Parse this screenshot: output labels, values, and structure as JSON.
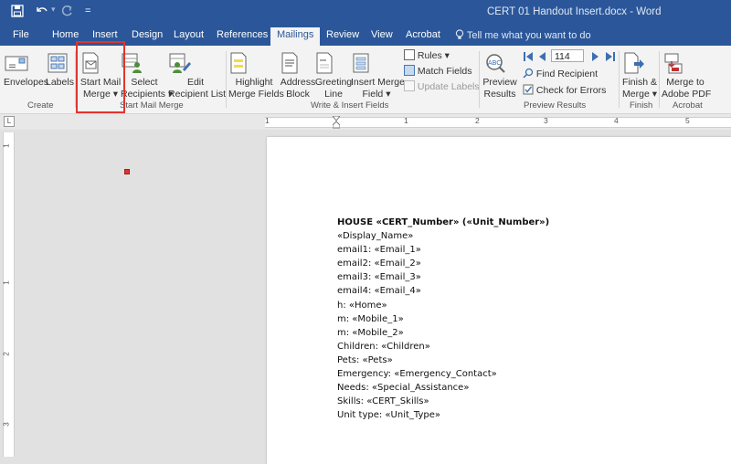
{
  "window": {
    "title": "CERT 01 Handout Insert.docx  -  Word"
  },
  "quick_access": {
    "save_icon": "save-icon",
    "undo_icon": "undo-icon",
    "redo_icon": "redo-icon",
    "customize_label": "="
  },
  "tabs": [
    {
      "label": "File"
    },
    {
      "label": "Home"
    },
    {
      "label": "Insert"
    },
    {
      "label": "Design"
    },
    {
      "label": "Layout"
    },
    {
      "label": "References"
    },
    {
      "label": "Mailings",
      "active": true
    },
    {
      "label": "Review"
    },
    {
      "label": "View"
    },
    {
      "label": "Acrobat"
    }
  ],
  "tell_me": "Tell me what you want to do",
  "ribbon": {
    "envelopes": "Envelopes",
    "labels": "Labels",
    "start_mail_1": "Start Mail",
    "start_mail_2": "Merge ▾",
    "select_1": "Select",
    "select_2": "Recipients ▾",
    "edit_1": "Edit",
    "edit_2": "Recipient List",
    "highlight_1": "Highlight",
    "highlight_2": "Merge Fields",
    "address_1": "Address",
    "address_2": "Block",
    "greeting_1": "Greeting",
    "greeting_2": "Line",
    "insert_1": "Insert Merge",
    "insert_2": "Field ▾",
    "rules": "Rules ▾",
    "match_fields": "Match Fields",
    "update_labels": "Update Labels",
    "preview_1": "Preview",
    "preview_2": "Results",
    "record_value": "114",
    "find_recipient": "Find Recipient",
    "check_errors": "Check for Errors",
    "finish_1": "Finish &",
    "finish_2": "Merge ▾",
    "adobe_1": "Merge to",
    "adobe_2": "Adobe PDF",
    "groups": {
      "create": "Create",
      "start": "Start Mail Merge",
      "write": "Write & Insert Fields",
      "preview": "Preview Results",
      "finish": "Finish",
      "acrobat": "Acrobat"
    }
  },
  "ruler": {
    "corner": "L",
    "numbers": [
      "1",
      "1",
      "2",
      "3",
      "4",
      "5"
    ],
    "vertical_numbers": [
      "1",
      "1",
      "2",
      "3"
    ]
  },
  "document": {
    "lines": [
      "HOUSE «CERT_Number» («Unit_Number»)",
      "«Display_Name»",
      "email1: «Email_1»",
      "email2: «Email_2»",
      "email3: «Email_3»",
      "email4: «Email_4»",
      "h: «Home»",
      "m: «Mobile_1»",
      "m: «Mobile_2»",
      "Children: «Children»",
      "Pets: «Pets»",
      "Emergency: «Emergency_Contact»",
      "Needs: «Special_Assistance»",
      "Skills: «CERT_Skills»",
      "Unit type: «Unit_Type»"
    ]
  },
  "colors": {
    "word_blue": "#2b579a",
    "highlight_red": "#e0352f"
  }
}
